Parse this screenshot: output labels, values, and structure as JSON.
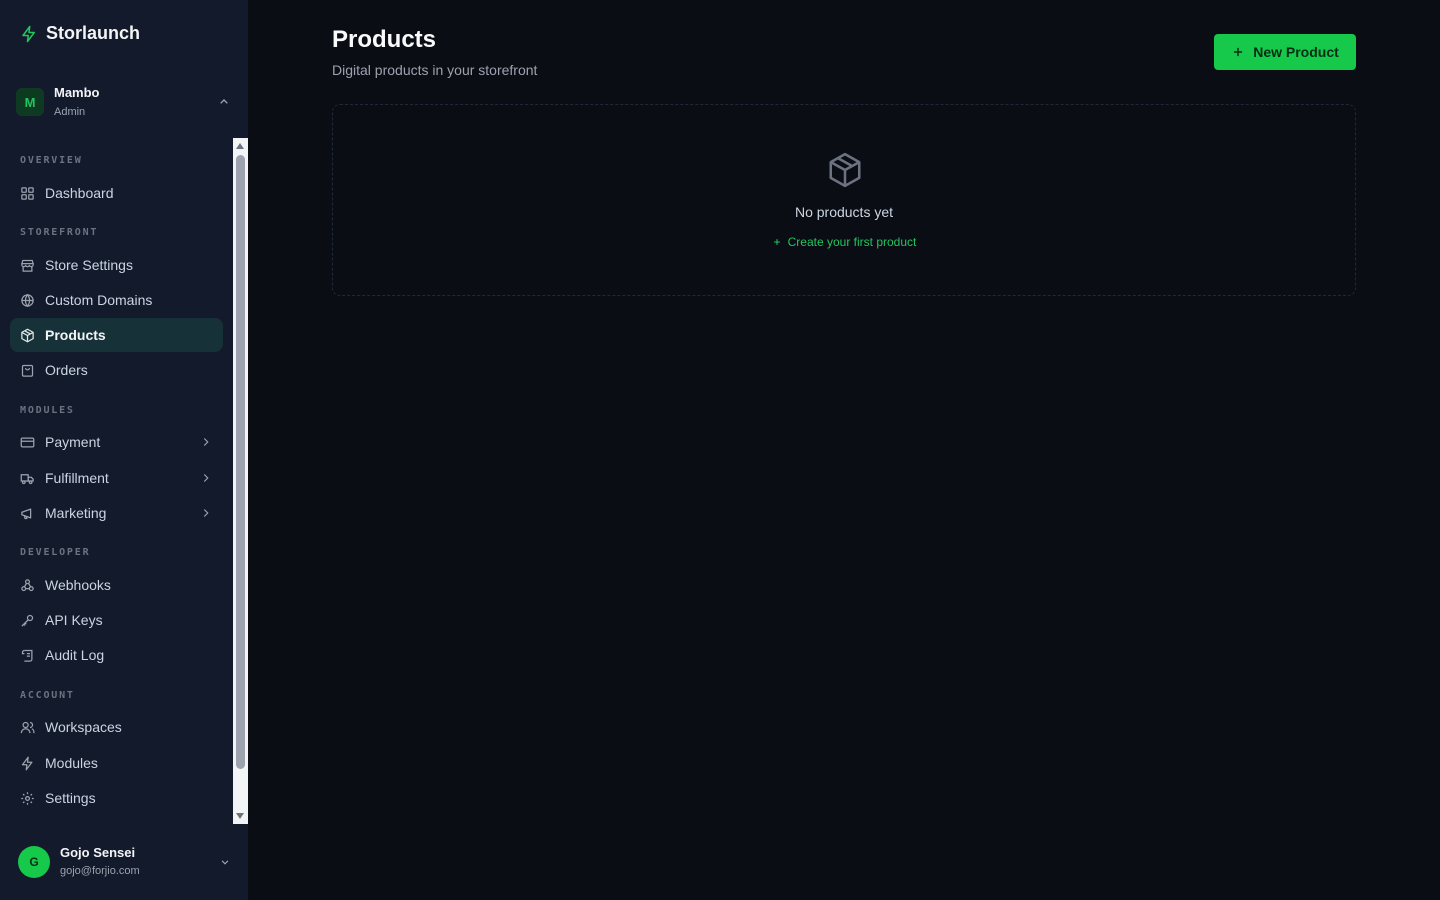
{
  "brand": {
    "name": "Storlaunch",
    "accent": "#16c94a"
  },
  "workspace": {
    "initial": "M",
    "name": "Mambo",
    "role": "Admin"
  },
  "nav": {
    "sections": [
      {
        "label": "OVERVIEW",
        "items": [
          {
            "label": "Dashboard",
            "icon": "grid-icon"
          }
        ]
      },
      {
        "label": "STOREFRONT",
        "items": [
          {
            "label": "Store Settings",
            "icon": "store-icon"
          },
          {
            "label": "Custom Domains",
            "icon": "globe-icon"
          },
          {
            "label": "Products",
            "icon": "package-icon",
            "active": true
          },
          {
            "label": "Orders",
            "icon": "bag-icon"
          }
        ]
      },
      {
        "label": "MODULES",
        "items": [
          {
            "label": "Payment",
            "icon": "credit-card-icon",
            "expandable": true
          },
          {
            "label": "Fulfillment",
            "icon": "truck-icon",
            "expandable": true
          },
          {
            "label": "Marketing",
            "icon": "megaphone-icon",
            "expandable": true
          }
        ]
      },
      {
        "label": "DEVELOPER",
        "items": [
          {
            "label": "Webhooks",
            "icon": "webhook-icon"
          },
          {
            "label": "API Keys",
            "icon": "key-icon"
          },
          {
            "label": "Audit Log",
            "icon": "scroll-icon"
          }
        ]
      },
      {
        "label": "ACCOUNT",
        "items": [
          {
            "label": "Workspaces",
            "icon": "users-icon"
          },
          {
            "label": "Modules",
            "icon": "zap-icon"
          },
          {
            "label": "Settings",
            "icon": "gear-icon"
          }
        ]
      }
    ]
  },
  "user": {
    "initial": "G",
    "name": "Gojo Sensei",
    "email": "gojo@forjio.com"
  },
  "page": {
    "title": "Products",
    "subtitle": "Digital products in your storefront",
    "new_button": "New Product",
    "empty_text": "No products yet",
    "empty_link": "Create your first product"
  }
}
